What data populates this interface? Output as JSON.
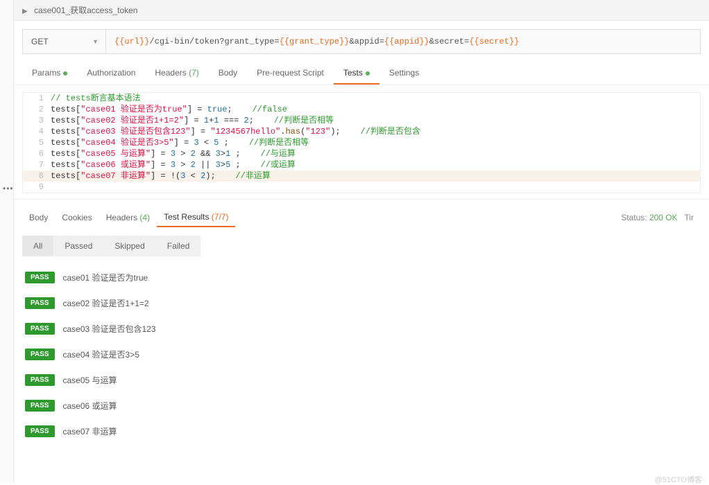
{
  "header": {
    "title": "case001_获取access_token"
  },
  "request": {
    "method": "GET",
    "url_parts": {
      "p0": "{{url}}",
      "p1": "/cgi-bin/token?grant_type=",
      "p2": "{{grant_type}}",
      "p3": "&appid=",
      "p4": "{{appid}}",
      "p5": "&secret=",
      "p6": "{{secret}}"
    }
  },
  "tabs": {
    "params": "Params",
    "authorization": "Authorization",
    "headers": "Headers",
    "headers_count": "(7)",
    "body": "Body",
    "prerequest": "Pre-request Script",
    "tests": "Tests",
    "settings": "Settings"
  },
  "editor_lines": [
    {
      "n": "1",
      "segs": [
        {
          "t": "// tests断言基本语法",
          "c": "c-comment"
        }
      ]
    },
    {
      "n": "2",
      "segs": [
        {
          "t": "tests["
        },
        {
          "t": "\"case01 验证是否为true\"",
          "c": "c-str"
        },
        {
          "t": "] = "
        },
        {
          "t": "true",
          "c": "c-kw"
        },
        {
          "t": ";    "
        },
        {
          "t": "//false",
          "c": "c-comment"
        }
      ]
    },
    {
      "n": "3",
      "segs": [
        {
          "t": "tests["
        },
        {
          "t": "\"case02 验证是否1+1=2\"",
          "c": "c-str"
        },
        {
          "t": "] = "
        },
        {
          "t": "1",
          "c": "c-num"
        },
        {
          "t": "+"
        },
        {
          "t": "1",
          "c": "c-num"
        },
        {
          "t": " === "
        },
        {
          "t": "2",
          "c": "c-num"
        },
        {
          "t": ";    "
        },
        {
          "t": "//判断是否相等",
          "c": "c-comment"
        }
      ]
    },
    {
      "n": "4",
      "segs": [
        {
          "t": "tests["
        },
        {
          "t": "\"case03 验证是否包含123\"",
          "c": "c-str"
        },
        {
          "t": "] = "
        },
        {
          "t": "\"1234567hello\"",
          "c": "c-str"
        },
        {
          "t": "."
        },
        {
          "t": "has",
          "c": "c-fn"
        },
        {
          "t": "("
        },
        {
          "t": "\"123\"",
          "c": "c-str"
        },
        {
          "t": ");    "
        },
        {
          "t": "//判断是否包含",
          "c": "c-comment"
        }
      ]
    },
    {
      "n": "5",
      "segs": [
        {
          "t": "tests["
        },
        {
          "t": "\"case04 验证是否3>5\"",
          "c": "c-str"
        },
        {
          "t": "] = "
        },
        {
          "t": "3",
          "c": "c-num"
        },
        {
          "t": " < "
        },
        {
          "t": "5",
          "c": "c-num"
        },
        {
          "t": " ;    "
        },
        {
          "t": "//判断是否相等",
          "c": "c-comment"
        }
      ]
    },
    {
      "n": "6",
      "segs": [
        {
          "t": "tests["
        },
        {
          "t": "\"case05 与运算\"",
          "c": "c-str"
        },
        {
          "t": "] = "
        },
        {
          "t": "3",
          "c": "c-num"
        },
        {
          "t": " > "
        },
        {
          "t": "2",
          "c": "c-num"
        },
        {
          "t": " && "
        },
        {
          "t": "3",
          "c": "c-num"
        },
        {
          "t": ">"
        },
        {
          "t": "1",
          "c": "c-num"
        },
        {
          "t": " ;    "
        },
        {
          "t": "//与运算",
          "c": "c-comment"
        }
      ]
    },
    {
      "n": "7",
      "segs": [
        {
          "t": "tests["
        },
        {
          "t": "\"case06 或运算\"",
          "c": "c-str"
        },
        {
          "t": "] = "
        },
        {
          "t": "3",
          "c": "c-num"
        },
        {
          "t": " > "
        },
        {
          "t": "2",
          "c": "c-num"
        },
        {
          "t": " || "
        },
        {
          "t": "3",
          "c": "c-num"
        },
        {
          "t": ">"
        },
        {
          "t": "5",
          "c": "c-num"
        },
        {
          "t": " ;    "
        },
        {
          "t": "//或运算",
          "c": "c-comment"
        }
      ]
    },
    {
      "n": "8",
      "hl": true,
      "segs": [
        {
          "t": "tests["
        },
        {
          "t": "\"case07 非运算\"",
          "c": "c-str"
        },
        {
          "t": "] = !("
        },
        {
          "t": "3",
          "c": "c-num"
        },
        {
          "t": " < "
        },
        {
          "t": "2",
          "c": "c-num"
        },
        {
          "t": ");    "
        },
        {
          "t": "//非运算",
          "c": "c-comment"
        }
      ]
    },
    {
      "n": "9",
      "segs": [
        {
          "t": " "
        }
      ]
    }
  ],
  "response": {
    "tabs": {
      "body": "Body",
      "cookies": "Cookies",
      "headers": "Headers",
      "headers_count": "(4)",
      "test_results": "Test Results",
      "test_results_count": "(7/7)"
    },
    "status_label": "Status:",
    "status_value": "200 OK",
    "time_label": "Tir",
    "filters": {
      "all": "All",
      "passed": "Passed",
      "skipped": "Skipped",
      "failed": "Failed"
    },
    "results": [
      {
        "status": "PASS",
        "name": "case01 验证是否为true"
      },
      {
        "status": "PASS",
        "name": "case02 验证是否1+1=2"
      },
      {
        "status": "PASS",
        "name": "case03 验证是否包含123"
      },
      {
        "status": "PASS",
        "name": "case04 验证是否3>5"
      },
      {
        "status": "PASS",
        "name": "case05 与运算"
      },
      {
        "status": "PASS",
        "name": "case06 或运算"
      },
      {
        "status": "PASS",
        "name": "case07 非运算"
      }
    ]
  },
  "watermark": "@51CTO博客"
}
